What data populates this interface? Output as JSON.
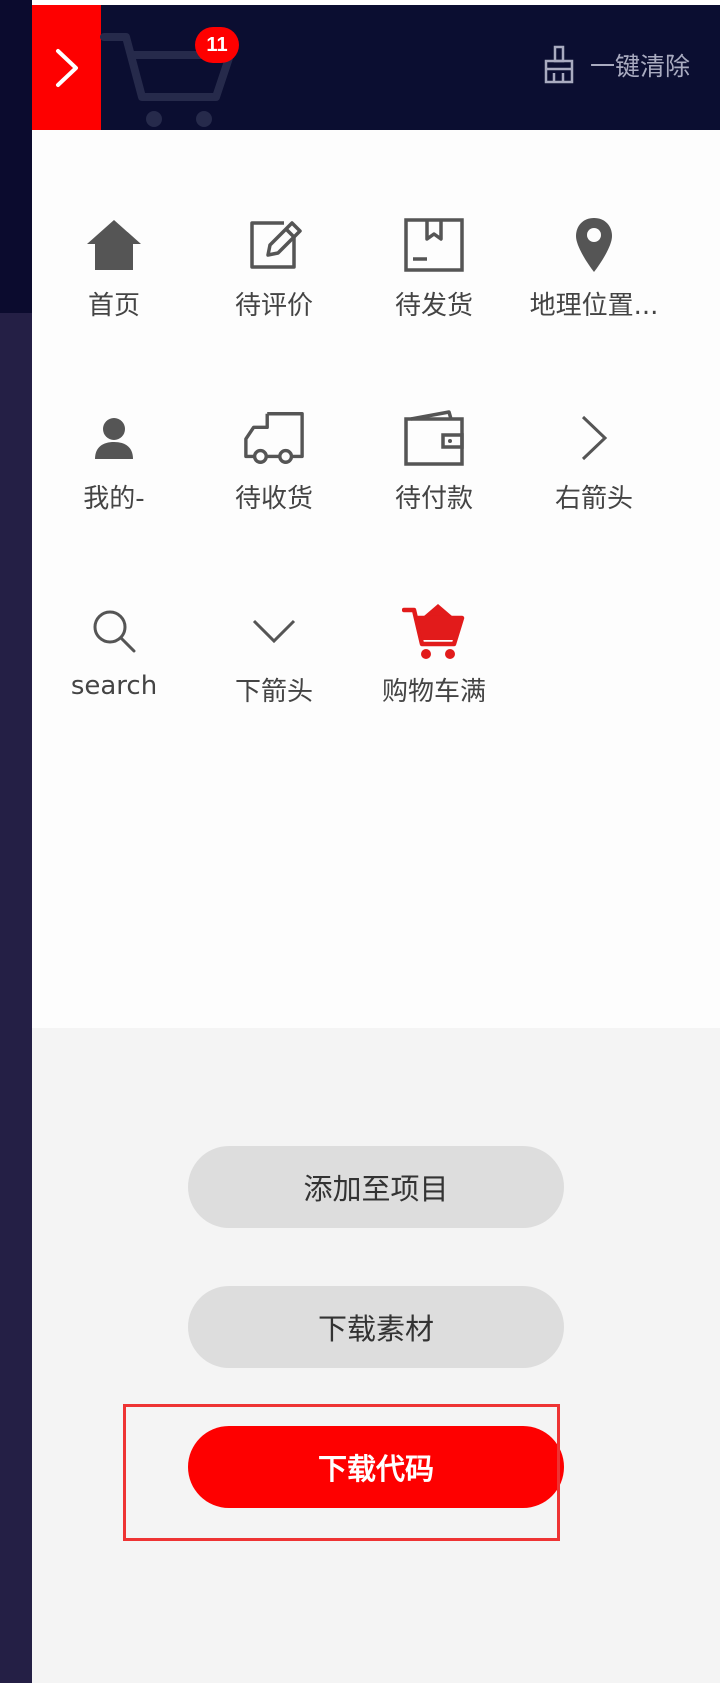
{
  "header": {
    "cart_count": "11",
    "clear_all_label": "一键清除"
  },
  "icons": [
    {
      "label": "首页",
      "icon": "home-icon"
    },
    {
      "label": "待评价",
      "icon": "edit-icon"
    },
    {
      "label": "待发货",
      "icon": "package-icon"
    },
    {
      "label": "地理位置...",
      "icon": "location-pin-icon"
    },
    {
      "label": "我的-",
      "icon": "user-icon"
    },
    {
      "label": "待收货",
      "icon": "truck-icon"
    },
    {
      "label": "待付款",
      "icon": "wallet-icon"
    },
    {
      "label": "右箭头",
      "icon": "chevron-right-icon"
    },
    {
      "label": "search",
      "icon": "search-icon"
    },
    {
      "label": "下箭头",
      "icon": "chevron-down-icon"
    },
    {
      "label": "购物车满",
      "icon": "cart-full-icon"
    }
  ],
  "actions": {
    "add_to_project": "添加至项目",
    "download_assets": "下载素材",
    "download_code": "下载代码"
  },
  "colors": {
    "accent": "#fe0000",
    "header_bg": "#0b0e31",
    "icon_gray": "#555555"
  }
}
